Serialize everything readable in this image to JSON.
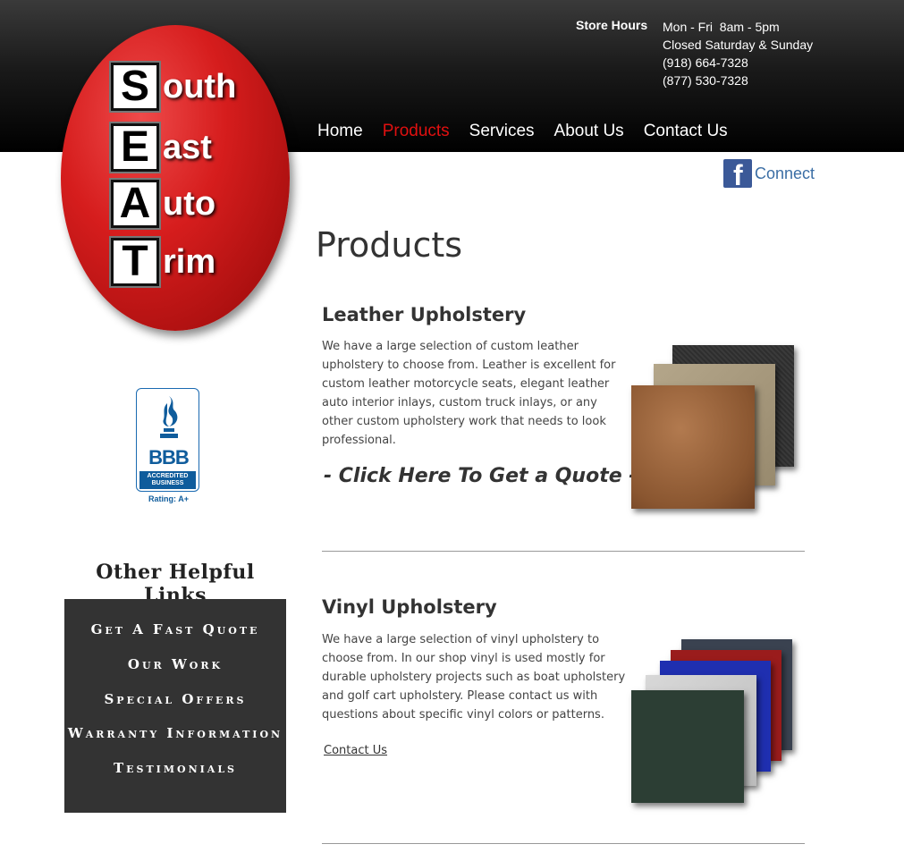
{
  "logo": {
    "letters": [
      "S",
      "E",
      "A",
      "T"
    ],
    "words": [
      "outh",
      "ast",
      "uto",
      "rim"
    ]
  },
  "store": {
    "hours_label": "Store Hours",
    "lines": [
      "Mon - Fri  8am - 5pm",
      "Closed Saturday & Sunday",
      "(918) 664-7328",
      "(877) 530-7328"
    ]
  },
  "nav": {
    "items": [
      {
        "label": "Home"
      },
      {
        "label": "Products"
      },
      {
        "label": "Services"
      },
      {
        "label": "About Us"
      },
      {
        "label": "Contact Us"
      }
    ],
    "active": "Products"
  },
  "social": {
    "fb_glyph": "f",
    "connect_label": "Connect"
  },
  "page": {
    "title": "Products"
  },
  "bbb": {
    "letters": "BBB",
    "accredited_line1": "ACCREDITED",
    "accredited_line2": "BUSINESS",
    "rating": "Rating: A+"
  },
  "sidebar": {
    "heading": "Other Helpful Links",
    "links": [
      {
        "label": "Get A Fast Quote"
      },
      {
        "label": "Our Work"
      },
      {
        "label": "Special Offers"
      },
      {
        "label": "Warranty Information"
      },
      {
        "label": "Testimonials"
      }
    ]
  },
  "products": {
    "leather": {
      "title": "Leather Upholstery",
      "description": "We have a large selection of custom leather upholstery to choose from. Leather is excellent for custom leather motorcycle seats, elegant leather auto interior inlays, custom truck inlays, or any other custom upholstery work that needs to look professional.",
      "quote_link": "- Click Here To Get a Quote -"
    },
    "vinyl": {
      "title": "Vinyl Upholstery",
      "description": "We have a large selection of vinyl upholstery to choose from. In our shop vinyl is used mostly for durable upholstery projects such as boat upholstery and golf cart upholstery. Please contact us with questions about specific vinyl colors or patterns.",
      "contact_link": "Contact Us"
    }
  },
  "colors": {
    "nav_active": "#e01010",
    "logo_red": "#d61d1d",
    "sidebar_bg": "#333333",
    "facebook_blue": "#3b5998",
    "bbb_blue": "#0f5c9c"
  }
}
